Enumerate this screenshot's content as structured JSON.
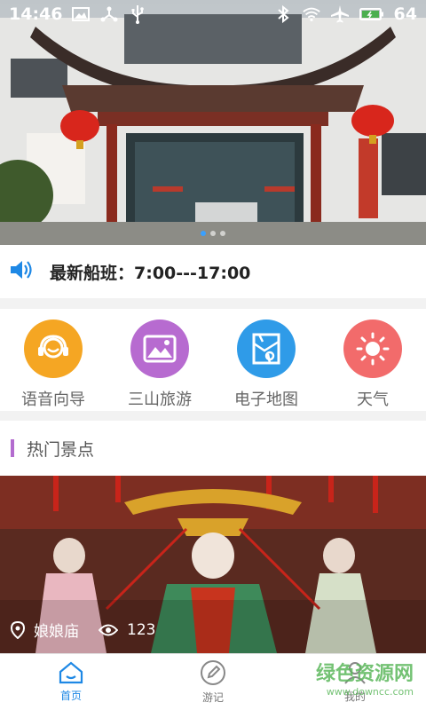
{
  "status_bar": {
    "time": "14:46",
    "battery": "64"
  },
  "banner": {
    "slides": 3,
    "active_slide": 1
  },
  "notice": {
    "text": "最新船班：7:00---17:00",
    "icon": "speaker-icon",
    "icon_color": "#1e88e5"
  },
  "features": [
    {
      "label": "语音向导",
      "icon": "headset-icon",
      "color": "#f5a623"
    },
    {
      "label": "三山旅游",
      "icon": "picture-icon",
      "color": "#b76bd0"
    },
    {
      "label": "电子地图",
      "icon": "map-icon",
      "color": "#2f9be8"
    },
    {
      "label": "天气",
      "icon": "sun-icon",
      "color": "#f26b6b"
    }
  ],
  "hot_section": {
    "title": "热门景点",
    "accent": "#b36ccf"
  },
  "spot": {
    "name": "娘娘庙",
    "views": "123"
  },
  "tabs": [
    {
      "label": "首页",
      "icon": "home-icon",
      "active": true
    },
    {
      "label": "游记",
      "icon": "pencil-icon",
      "active": false
    },
    {
      "label": "我的",
      "icon": "user-icon",
      "active": false
    }
  ],
  "watermark": {
    "main": "绿色资源网",
    "sub": "www.downcc.com"
  }
}
